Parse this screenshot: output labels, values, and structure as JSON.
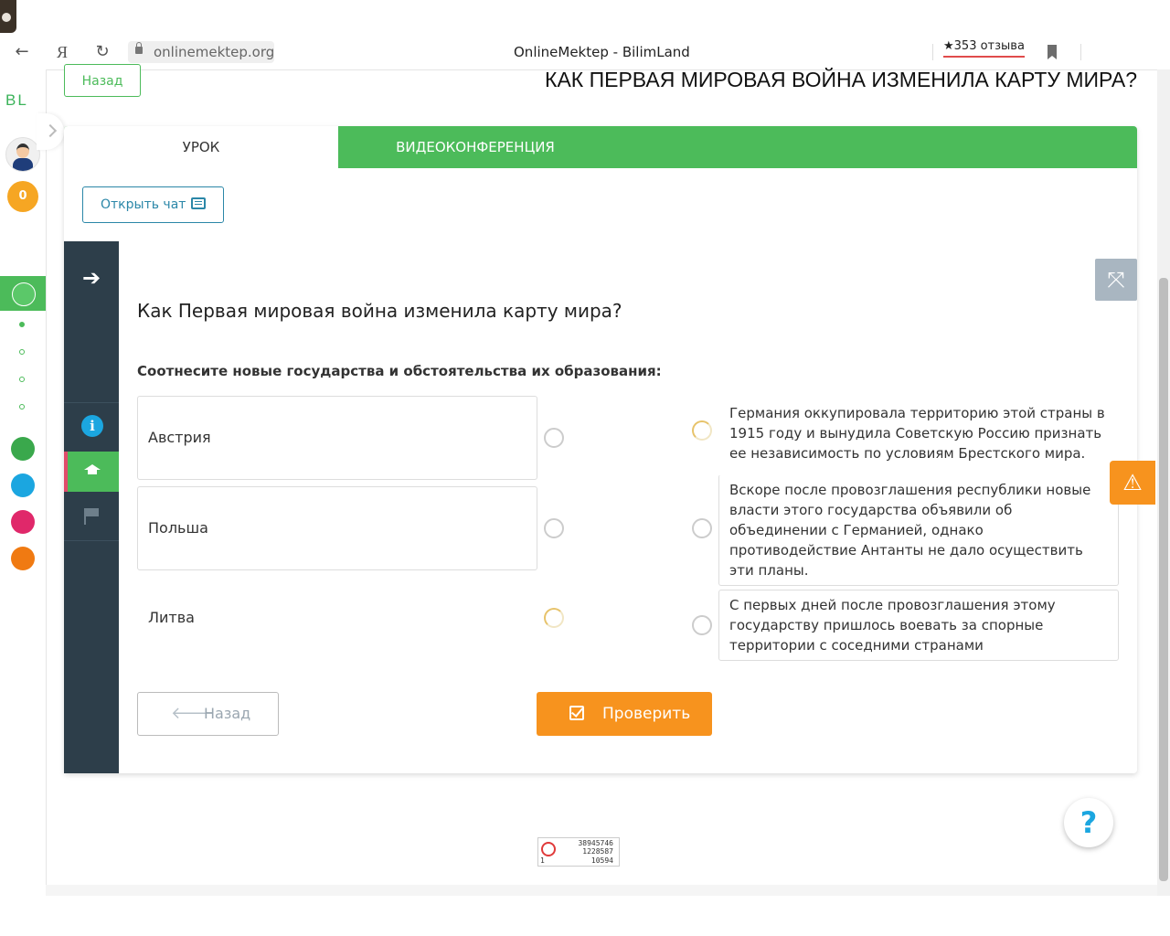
{
  "browser": {
    "url": "onlinemektep.org",
    "page_title": "OnlineMektep - BilimLand",
    "reviews": "★353 отзыва",
    "yandex_button": "Я"
  },
  "sidebar": {
    "logo": "BL",
    "coins": "0",
    "apps": [
      "online-mektep-icon",
      "bilimland-icon",
      "test-icon",
      "twig-icon",
      "mektep-icon"
    ]
  },
  "header": {
    "back_label": "Назад",
    "lesson_title": "КАК ПЕРВАЯ МИРОВАЯ ВОЙНА ИЗМЕНИЛА КАРТУ МИРА?"
  },
  "tabs": {
    "lesson": "УРОК",
    "video": "ВИДЕОКОНФЕРЕНЦИЯ"
  },
  "chat": {
    "label": "Открыть чат"
  },
  "question": {
    "title": "Как Первая мировая война изменила карту мира?",
    "instruction": "Соотнесите новые государства и обстоятельства их образования:",
    "left": [
      "Австрия",
      "Польша",
      "Литва"
    ],
    "right": [
      "Германия оккупировала территорию этой страны в 1915 году и вынудила Советскую Россию признать ее независимость по условиям Брестского мира.",
      "Вскоре после провозглашения республики новые власти этого государства объявили об объединении с Германией, однако противодействие Антанты не дало осуществить эти планы.",
      "С первых дней после провозглашения этому государству пришлось воевать за спорные территории с соседними странами"
    ]
  },
  "buttons": {
    "back": "Назад",
    "check": "Проверить"
  },
  "counter": {
    "line1": "38945746",
    "line2": "1228587",
    "line3": "10594",
    "line0": "1"
  },
  "colors": {
    "green": "#4cbb5a",
    "orange": "#f7931e",
    "dark_panel": "#2d3e4a",
    "blue": "#2b87a8"
  }
}
